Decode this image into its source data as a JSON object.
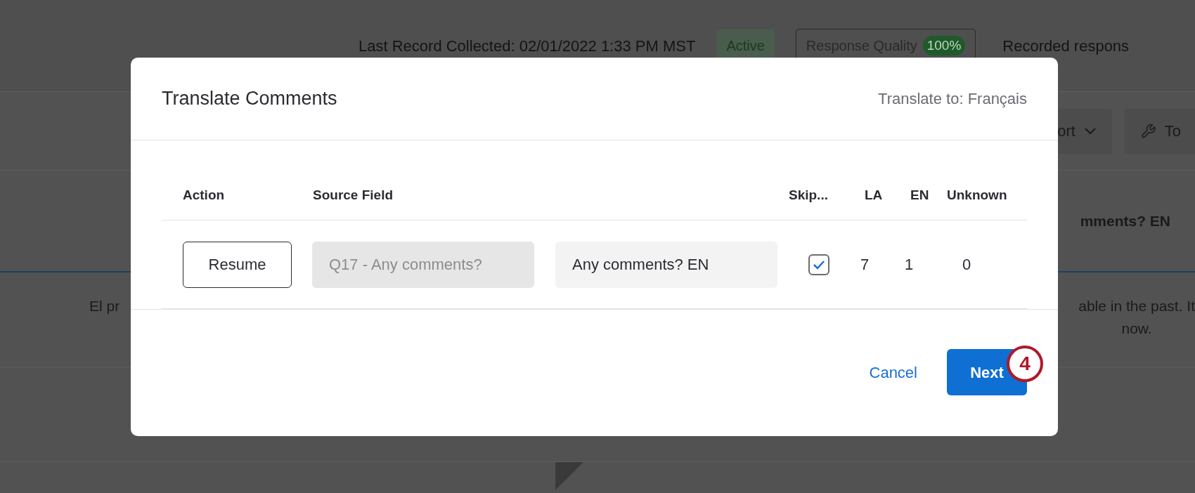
{
  "background": {
    "status_text": "Last Record Collected: 02/01/2022 1:33 PM MST",
    "status_badge": "Active",
    "quality": {
      "label": "Response Quality",
      "score": "100%"
    },
    "recorded": "Recorded respons",
    "toolbar": [
      {
        "kind": "dropdown",
        "label": "ort"
      },
      {
        "kind": "tool",
        "label": "To"
      }
    ],
    "column_heading": "mments? EN",
    "notice_left": "El pr",
    "notice_right": [
      "able in the past. It",
      "now."
    ]
  },
  "dialog": {
    "title": "Translate Comments",
    "target_language": "Translate to: Français",
    "columns": [
      "Action",
      "Source Field",
      "Skip...",
      "LA",
      "EN",
      "Unknown"
    ],
    "rows": [
      {
        "action": "Resume",
        "source_field": "Q17 - Any comments?",
        "target_field": "Any comments? EN",
        "skip": true,
        "la": "7",
        "en": "1",
        "unknown": "0"
      }
    ],
    "buttons": [
      {
        "kind": "link",
        "label": "Cancel"
      },
      {
        "kind": "primary",
        "label": "Next"
      }
    ],
    "step_badge": "4"
  }
}
